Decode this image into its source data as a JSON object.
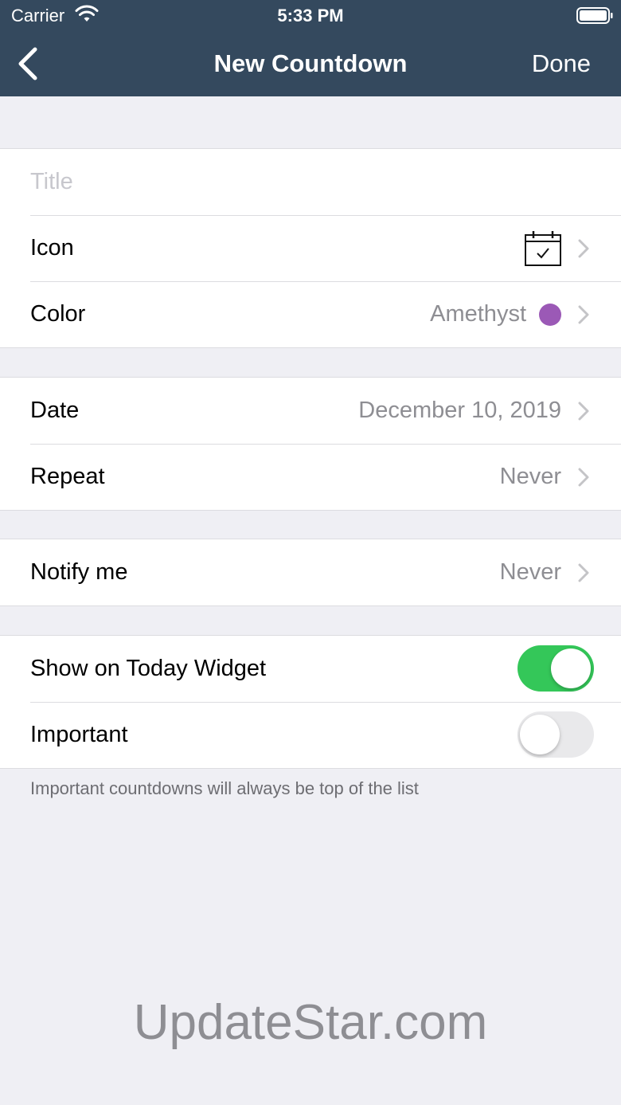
{
  "status_bar": {
    "carrier": "Carrier",
    "time": "5:33 PM"
  },
  "nav": {
    "title": "New Countdown",
    "done_label": "Done",
    "back_icon": "chevron-left-icon"
  },
  "form": {
    "title_placeholder": "Title",
    "title_value": "",
    "icon_label": "Icon",
    "icon_name": "calendar-check-icon",
    "color_label": "Color",
    "color_value": "Amethyst",
    "color_hex": "#9b59b6",
    "date_label": "Date",
    "date_value": "December 10, 2019",
    "repeat_label": "Repeat",
    "repeat_value": "Never",
    "notify_label": "Notify me",
    "notify_value": "Never",
    "widget_label": "Show on Today Widget",
    "widget_on": true,
    "important_label": "Important",
    "important_on": false,
    "important_note": "Important countdowns will always be top of the list"
  },
  "watermark": "UpdateStar.com",
  "colors": {
    "nav_bg": "#34495e",
    "toggle_on": "#34c759",
    "background": "#efeff4"
  }
}
